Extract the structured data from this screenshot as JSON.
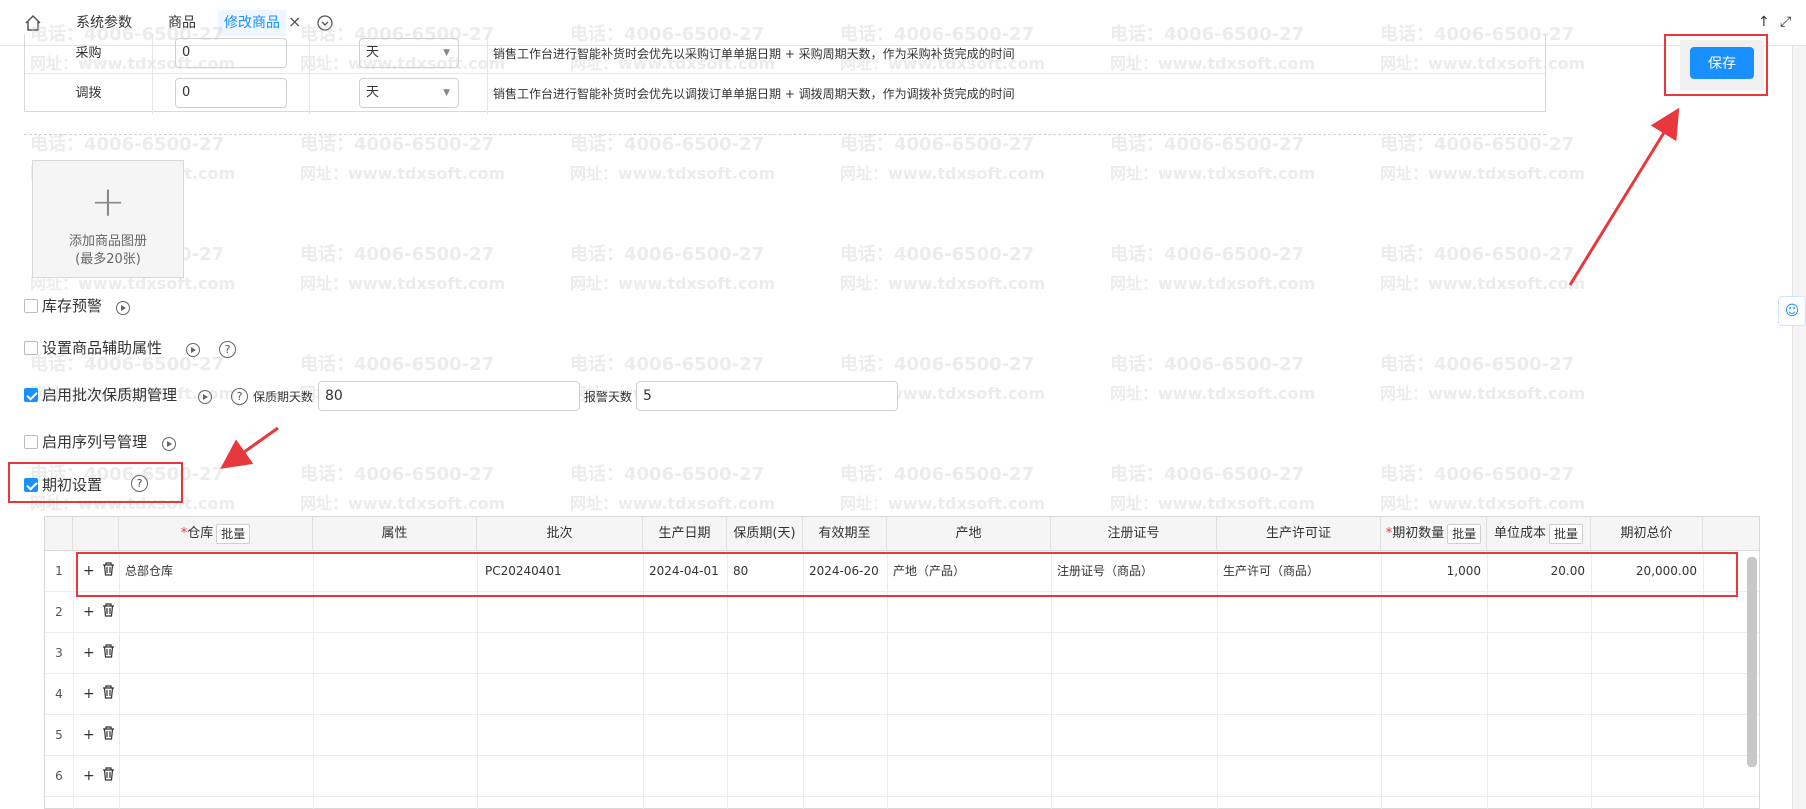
{
  "tabs": {
    "home_icon": "home-icon",
    "items": [
      {
        "label": "系统参数"
      },
      {
        "label": "商品"
      },
      {
        "label": "修改商品"
      }
    ],
    "close": "×",
    "more_icon": "chevron-down-circle-icon",
    "right_icons": [
      "↑",
      "⤢"
    ]
  },
  "cycle": {
    "rows": [
      {
        "label": "采购",
        "value": "0",
        "unit": "天",
        "desc": "销售工作台进行智能补货时会优先以采购订单单据日期 + 采购周期天数，作为采购补货完成的时间"
      },
      {
        "label": "调拨",
        "value": "0",
        "unit": "天",
        "desc": "销售工作台进行智能补货时会优先以调拨订单单据日期 + 调拨周期天数，作为调拨补货完成的时间"
      }
    ]
  },
  "save_label": "保存",
  "upload": {
    "plus": "+",
    "line1": "添加商品图册",
    "line2": "(最多20张)"
  },
  "options": {
    "stock_warning": {
      "label": "库存预警",
      "checked": false
    },
    "aux_attr": {
      "label": "设置商品辅助属性",
      "checked": false
    },
    "batch": {
      "label": "启用批次保质期管理",
      "checked": true,
      "shelf_label": "保质期天数",
      "shelf_value": "80",
      "alarm_label": "报警天数",
      "alarm_value": "5"
    },
    "serial": {
      "label": "启用序列号管理",
      "checked": false
    },
    "opening": {
      "label": "期初设置",
      "checked": true
    }
  },
  "help_glyph": "?",
  "grid": {
    "batch_btn": "批量",
    "columns": [
      "仓库",
      "属性",
      "批次",
      "生产日期",
      "保质期(天)",
      "有效期至",
      "产地",
      "注册证号",
      "生产许可证",
      "期初数量",
      "单位成本",
      "期初总价"
    ],
    "rows": [
      {
        "num": "1",
        "warehouse": "总部仓库",
        "attr": "",
        "batch": "PC20240401",
        "mfg": "2024-04-01",
        "shelf": "80",
        "expire": "2024-06-20",
        "origin": "产地（产品）",
        "reg": "注册证号（商品）",
        "license": "生产许可（商品）",
        "qty": "1,000",
        "cost": "20.00",
        "total": "20,000.00"
      },
      {
        "num": "2"
      },
      {
        "num": "3"
      },
      {
        "num": "4"
      },
      {
        "num": "5"
      },
      {
        "num": "6"
      }
    ],
    "add_glyph": "+",
    "delete_icon": "trash-icon"
  },
  "watermark": {
    "phone": "电话：4006-6500-27",
    "site": "网址：www.tdxsoft.com"
  },
  "colors": {
    "accent": "#1890ff",
    "highlight": "#e8383d"
  }
}
